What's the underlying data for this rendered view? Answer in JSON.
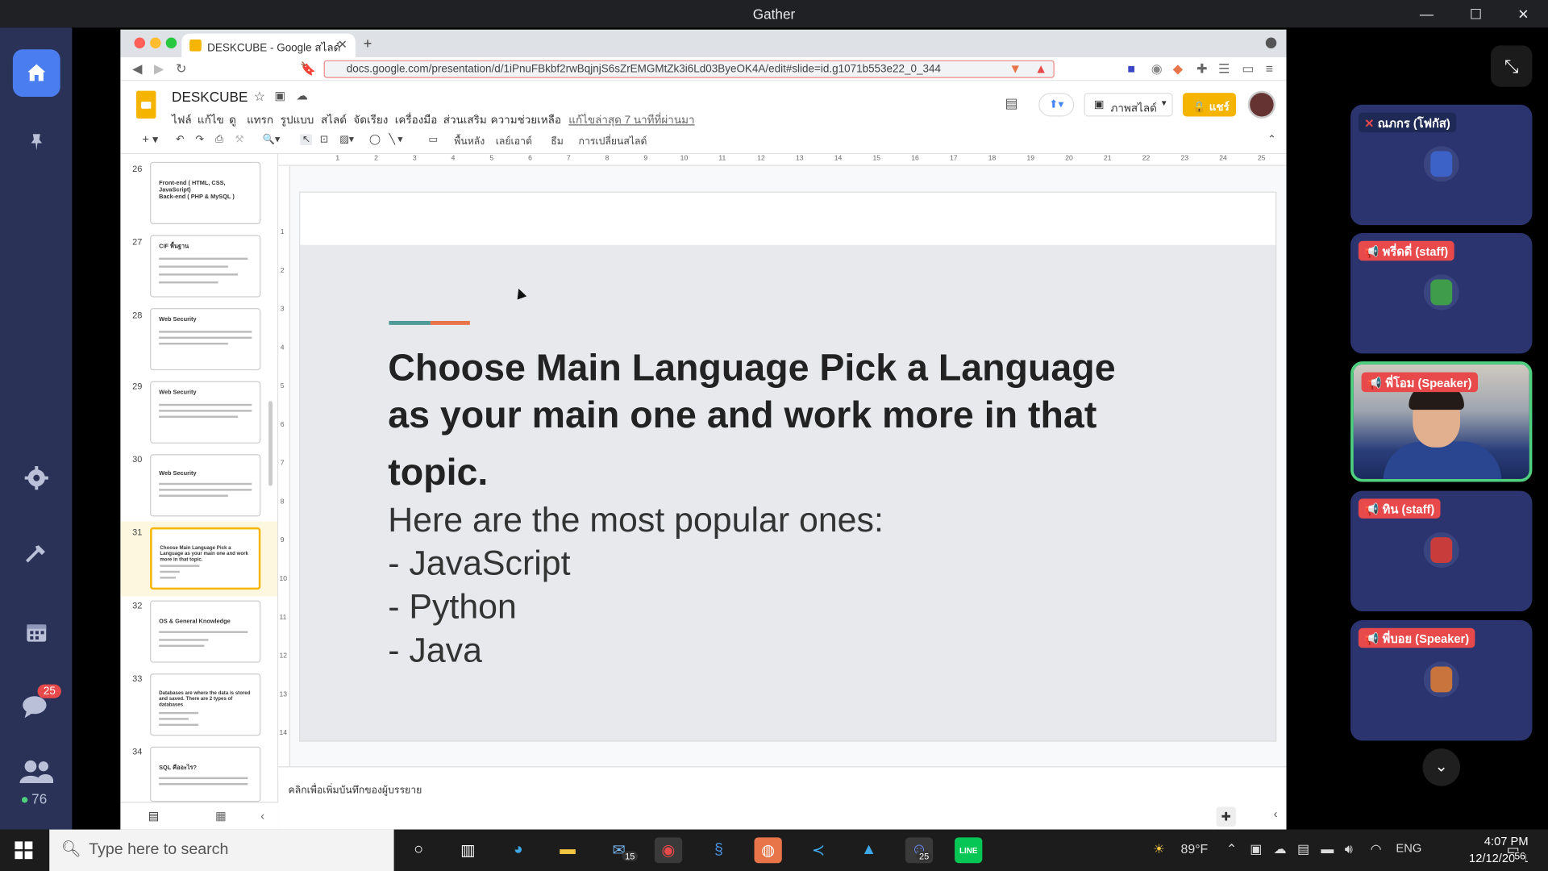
{
  "window": {
    "title": "Gather"
  },
  "browser": {
    "tab_title": "DESKCUBE - Google สไลด์",
    "url": "docs.google.com/presentation/d/1iPnuFBkbf2rwBqjnjS6sZrEMGMtZk3i6Ld03ByeOK4A/edit#slide=id.g1071b553e22_0_344"
  },
  "doc": {
    "title": "DESKCUBE",
    "menus": [
      "ไฟล์",
      "แก้ไข",
      "ดู",
      "แทรก",
      "รูปแบบ",
      "สไลด์",
      "จัดเรียง",
      "เครื่องมือ",
      "ส่วนเสริม",
      "ความช่วยเหลือ"
    ],
    "last_edit": "แก้ไขล่าสุด 7 นาทีที่ผ่านมา",
    "slideshow_label": "ภาพสไลด์",
    "share_label": "แชร์"
  },
  "toolbar": {
    "background_label": "พื้นหลัง",
    "layout_label": "เลย์เอาต์",
    "theme_label": "ธีม",
    "transition_label": "การเปลี่ยนสไลด์"
  },
  "ruler_ticks": [
    "1",
    "2",
    "3",
    "4",
    "5",
    "6",
    "7",
    "8",
    "9",
    "10",
    "11",
    "12",
    "13",
    "14",
    "15",
    "16",
    "17",
    "18",
    "19",
    "20",
    "21",
    "22",
    "23",
    "24",
    "25"
  ],
  "vruler_ticks": [
    "1",
    "2",
    "3",
    "4",
    "5",
    "6",
    "7",
    "8",
    "9",
    "10",
    "11",
    "12",
    "13",
    "14"
  ],
  "thumbnails": [
    {
      "num": "26",
      "title": "Front-end ( HTML, CSS, JavaScript)\nBack-end ( PHP & MySQL )"
    },
    {
      "num": "27",
      "title": "CIF พื้นฐาน"
    },
    {
      "num": "28",
      "title": "Web Security"
    },
    {
      "num": "29",
      "title": "Web Security"
    },
    {
      "num": "30",
      "title": "Web Security"
    },
    {
      "num": "31",
      "title": "Choose Main Language Pick a Language as your main one and work more in that topic."
    },
    {
      "num": "32",
      "title": "OS & General Knowledge"
    },
    {
      "num": "33",
      "title": "Databases are where the data is stored and saved. There are 2 types of databases"
    },
    {
      "num": "34",
      "title": "SQL คืออะไร?"
    }
  ],
  "slide": {
    "title_line1": "Choose Main Language Pick a Language",
    "title_line2": "as your main one and work more in that",
    "title_line3": "topic.",
    "body": [
      "Here are the most popular ones:",
      "- JavaScript",
      "- Python",
      "- Java"
    ]
  },
  "notes_placeholder": "คลิกเพื่อเพิ่มบันทึกของผู้บรรยาย",
  "gather": {
    "chat_badge": "25",
    "people_count": "76",
    "participants": [
      {
        "name": "ณภกร (โฟกัส)"
      },
      {
        "name": "พรี่ดดี่ (staff)"
      },
      {
        "name": "พี่โอม (Speaker)"
      },
      {
        "name": "ทิน (staff)"
      },
      {
        "name": "พี่บอย (Speaker)"
      }
    ]
  },
  "taskbar": {
    "search_placeholder": "Type here to search",
    "mail_badge": "15",
    "app_badge": "25",
    "weather": "89°F",
    "lang": "ENG",
    "time": "4:07 PM",
    "date": "12/12/2021",
    "notif_count": "56"
  }
}
